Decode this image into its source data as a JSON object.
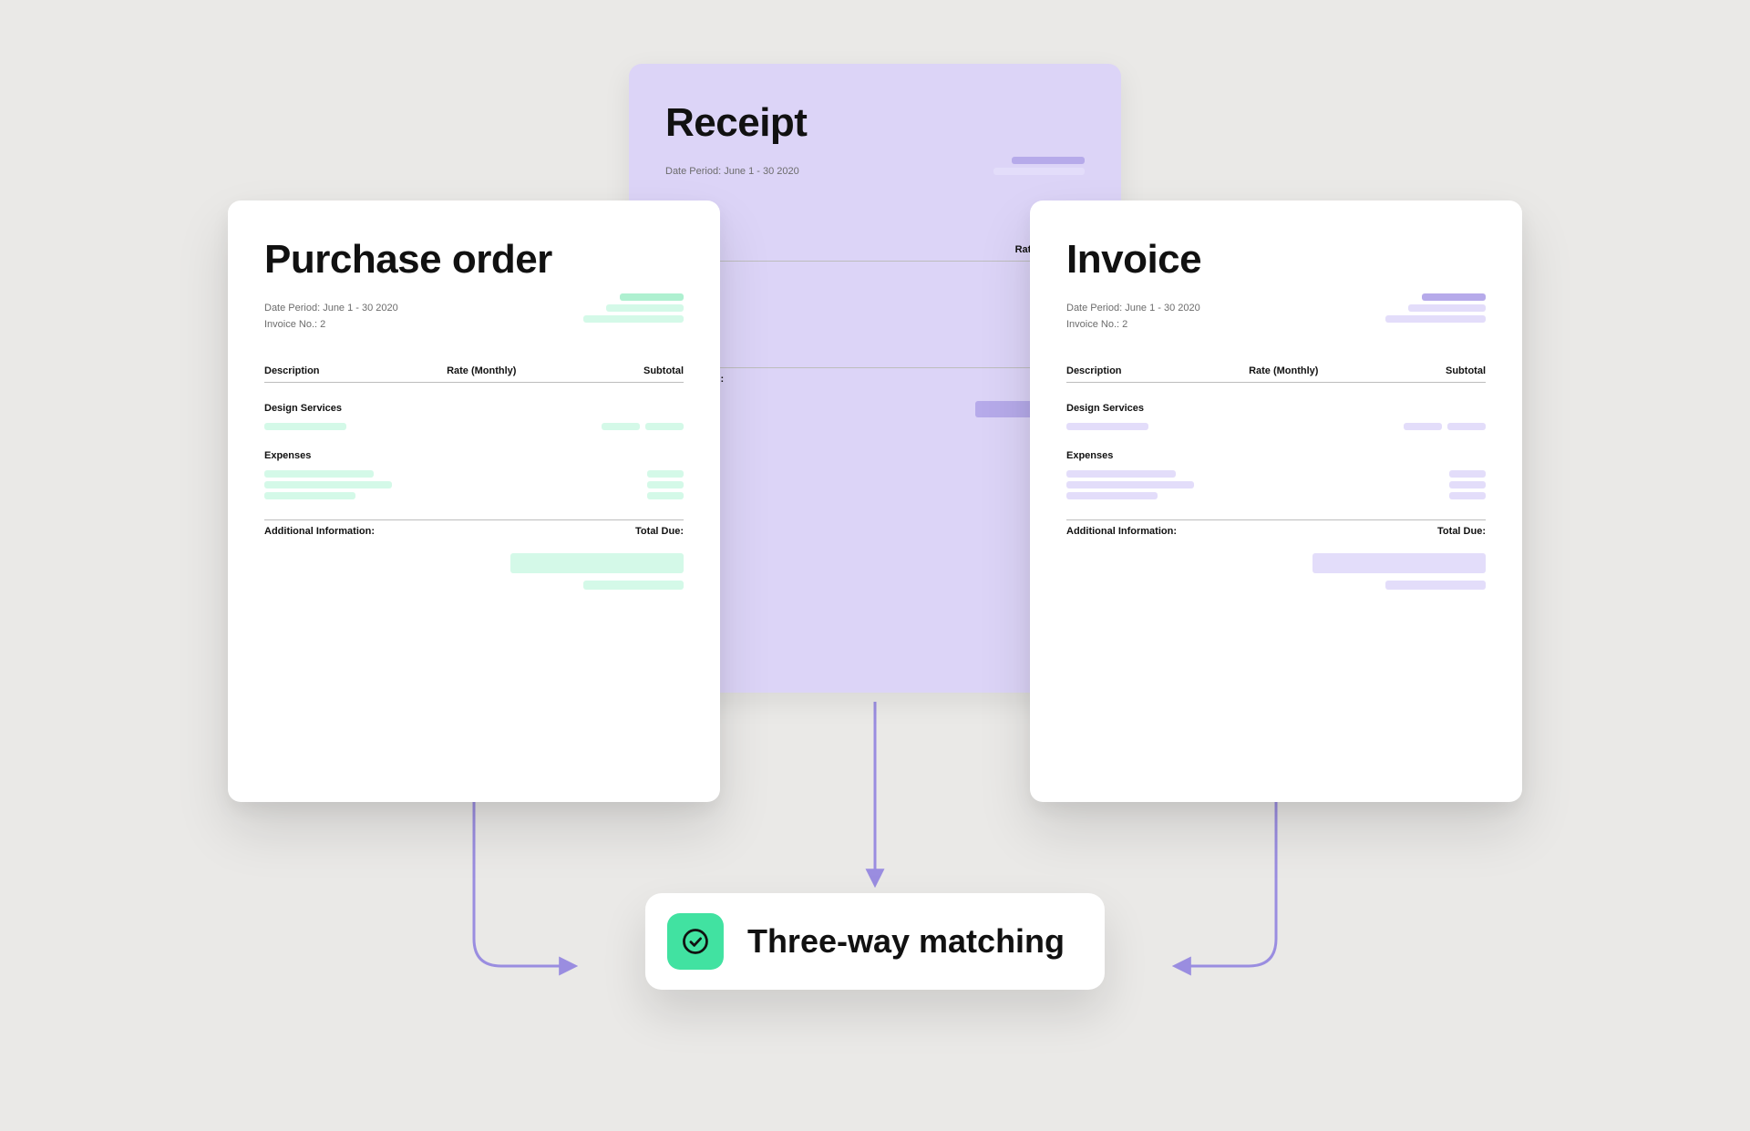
{
  "cards": {
    "purchase_order": {
      "title": "Purchase order",
      "meta_line1": "Date Period: June 1 - 30 2020",
      "meta_line2": "Invoice No.: 2",
      "col_description": "Description",
      "col_rate": "Rate (Monthly)",
      "col_subtotal": "Subtotal",
      "section1": "Design Services",
      "section2": "Expenses",
      "footer_left": "Additional Information:",
      "footer_right": "Total Due:"
    },
    "receipt": {
      "title": "Receipt",
      "meta_line1": "Date Period: June 1 - 30 2020",
      "col_rate": "Rate (Monthly)",
      "footer_left": "Information:"
    },
    "invoice": {
      "title": "Invoice",
      "meta_line1": "Date Period: June 1 - 30 2020",
      "meta_line2": "Invoice No.: 2",
      "col_description": "Description",
      "col_rate": "Rate (Monthly)",
      "col_subtotal": "Subtotal",
      "section1": "Design Services",
      "section2": "Expenses",
      "footer_left": "Additional Information:",
      "footer_right": "Total Due:"
    }
  },
  "result": {
    "label": "Three-way matching"
  },
  "colors": {
    "mint": "#aef0d0",
    "violet": "#b6aaea",
    "receipt_bg": "#dcd4f7",
    "result_green": "#41e2a1",
    "arrow": "#9a8de0"
  }
}
